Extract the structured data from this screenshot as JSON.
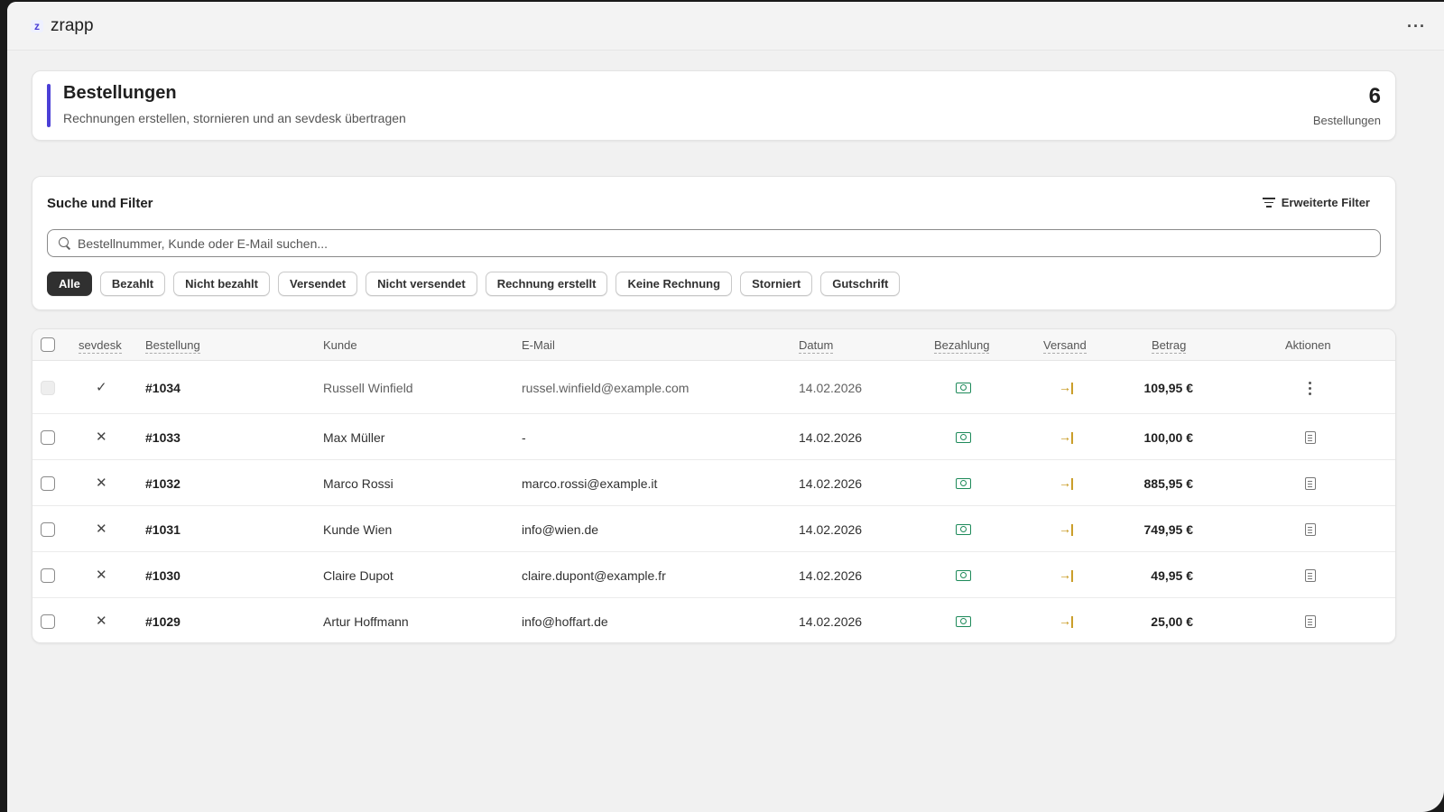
{
  "app": {
    "name": "zrapp",
    "logo_glyph": "z",
    "more_label": "···"
  },
  "header": {
    "title": "Bestellungen",
    "subtitle": "Rechnungen erstellen, stornieren und an sevdesk übertragen",
    "count": "6",
    "count_label": "Bestellungen",
    "accent_color": "#4b3fd6"
  },
  "filters": {
    "title": "Suche und Filter",
    "advanced_label": "Erweiterte Filter",
    "search_placeholder": "Bestellnummer, Kunde oder E-Mail suchen...",
    "chips": [
      {
        "label": "Alle",
        "active": true
      },
      {
        "label": "Bezahlt",
        "active": false
      },
      {
        "label": "Nicht bezahlt",
        "active": false
      },
      {
        "label": "Versendet",
        "active": false
      },
      {
        "label": "Nicht versendet",
        "active": false
      },
      {
        "label": "Rechnung erstellt",
        "active": false
      },
      {
        "label": "Keine Rechnung",
        "active": false
      },
      {
        "label": "Storniert",
        "active": false
      },
      {
        "label": "Gutschrift",
        "active": false
      }
    ]
  },
  "table": {
    "columns": {
      "sevdesk": "sevdesk",
      "order": "Bestellung",
      "customer": "Kunde",
      "email": "E-Mail",
      "date": "Datum",
      "payment": "Bezahlung",
      "shipping": "Versand",
      "amount": "Betrag",
      "actions": "Aktionen"
    },
    "rows": [
      {
        "sevdesk": "✓",
        "order": "#1034",
        "customer": "Russell Winfield",
        "email": "russel.winfield@example.com",
        "date": "14.02.2026",
        "amount": "109,95 €",
        "payment_icon": "cash-icon",
        "shipping_icon": "shipped-icon",
        "action_icon": "kebab-menu-icon",
        "selectable": false,
        "muted": true
      },
      {
        "sevdesk": "✕",
        "order": "#1033",
        "customer": "Max Müller",
        "email": "-",
        "date": "14.02.2026",
        "amount": "100,00 €",
        "payment_icon": "cash-icon",
        "shipping_icon": "shipped-icon",
        "action_icon": "invoice-icon",
        "selectable": true,
        "muted": false
      },
      {
        "sevdesk": "✕",
        "order": "#1032",
        "customer": "Marco Rossi",
        "email": "marco.rossi@example.it",
        "date": "14.02.2026",
        "amount": "885,95 €",
        "payment_icon": "cash-icon",
        "shipping_icon": "shipped-icon",
        "action_icon": "invoice-icon",
        "selectable": true,
        "muted": false
      },
      {
        "sevdesk": "✕",
        "order": "#1031",
        "customer": "Kunde Wien",
        "email": "info@wien.de",
        "date": "14.02.2026",
        "amount": "749,95 €",
        "payment_icon": "cash-icon",
        "shipping_icon": "shipped-icon",
        "action_icon": "invoice-icon",
        "selectable": true,
        "muted": false
      },
      {
        "sevdesk": "✕",
        "order": "#1030",
        "customer": "Claire Dupot",
        "email": "claire.dupont@example.fr",
        "date": "14.02.2026",
        "amount": "49,95 €",
        "payment_icon": "cash-icon",
        "shipping_icon": "shipped-icon",
        "action_icon": "invoice-icon",
        "selectable": true,
        "muted": false
      },
      {
        "sevdesk": "✕",
        "order": "#1029",
        "customer": "Artur Hoffmann",
        "email": "info@hoffart.de",
        "date": "14.02.2026",
        "amount": "25,00 €",
        "payment_icon": "cash-icon",
        "shipping_icon": "shipped-icon",
        "action_icon": "invoice-icon",
        "selectable": true,
        "muted": false
      }
    ]
  },
  "colors": {
    "payment": "#1e8a5a",
    "shipping": "#c49312",
    "dark_chip": "#303030"
  }
}
